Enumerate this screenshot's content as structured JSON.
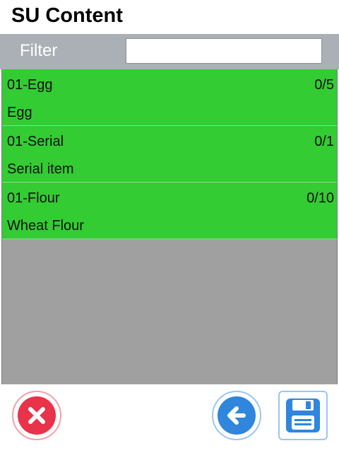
{
  "header": {
    "title": "SU Content"
  },
  "filter": {
    "label": "Filter",
    "value": "",
    "placeholder": ""
  },
  "items": [
    {
      "code": "01-Egg",
      "qty": "0/5",
      "description": "Egg"
    },
    {
      "code": "01-Serial",
      "qty": "0/1",
      "description": "Serial item"
    },
    {
      "code": "01-Flour",
      "qty": "0/10",
      "description": "Wheat Flour"
    }
  ],
  "buttons": {
    "cancel": {
      "icon": "close-icon",
      "color": "#e8334a"
    },
    "back": {
      "icon": "arrow-left-icon",
      "color": "#2f86dc"
    },
    "save": {
      "icon": "floppy-disk-icon",
      "color": "#2f86dc"
    }
  },
  "colors": {
    "item_bg": "#33cc33",
    "list_bg": "#a0a0a0",
    "filter_bar": "#aab0b5"
  }
}
